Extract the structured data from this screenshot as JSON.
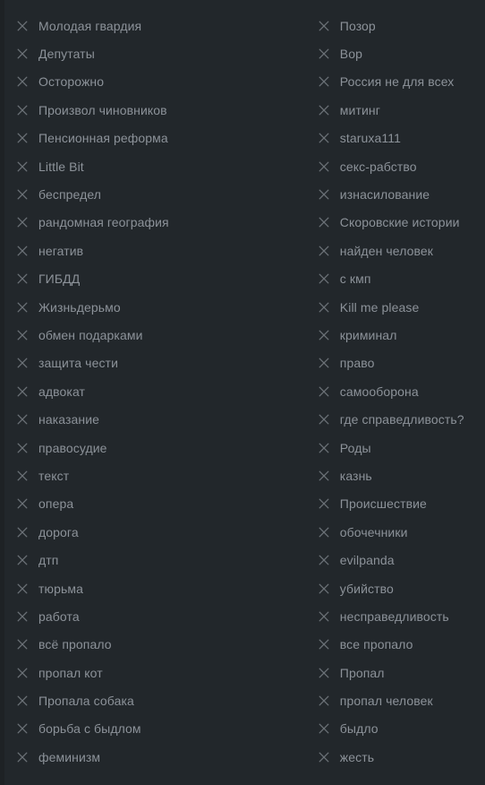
{
  "panel": {
    "name": "tag-list-panel",
    "icon": "close-x-icon",
    "colors": {
      "background": "#22272b",
      "gutter": "#1e2225",
      "label_text": "#8c9299",
      "icon": "#6b7177"
    }
  },
  "columns": [
    {
      "name": "left-column",
      "tags": [
        "Молодая гвардия",
        "Депутаты",
        "Осторожно",
        "Произвол чиновников",
        "Пенсионная реформа",
        "Little Bit",
        "беспредел",
        "рандомная география",
        "негатив",
        "ГИБДД",
        "Жизньдерьмо",
        "обмен подарками",
        "защита чести",
        "адвокат",
        "наказание",
        "правосудие",
        "текст",
        "опера",
        "дорога",
        "дтп",
        "тюрьма",
        "работа",
        "всё пропало",
        "пропал кот",
        "Пропала собака",
        "борьба с быдлом",
        "феминизм"
      ]
    },
    {
      "name": "right-column",
      "tags": [
        "Позор",
        "Вор",
        "Россия не для всех",
        "митинг",
        "staruxa111",
        "секс-рабство",
        "изнасилование",
        "Скоровские истории",
        "найден человек",
        "с кмп",
        "Kill me please",
        "криминал",
        "право",
        "самооборона",
        "где справедливость?",
        "Роды",
        "казнь",
        "Происшествие",
        "обочечники",
        "evilpanda",
        "убийство",
        "несправедливость",
        "все пропало",
        "Пропал",
        "пропал человек",
        "быдло",
        "жесть"
      ]
    }
  ]
}
